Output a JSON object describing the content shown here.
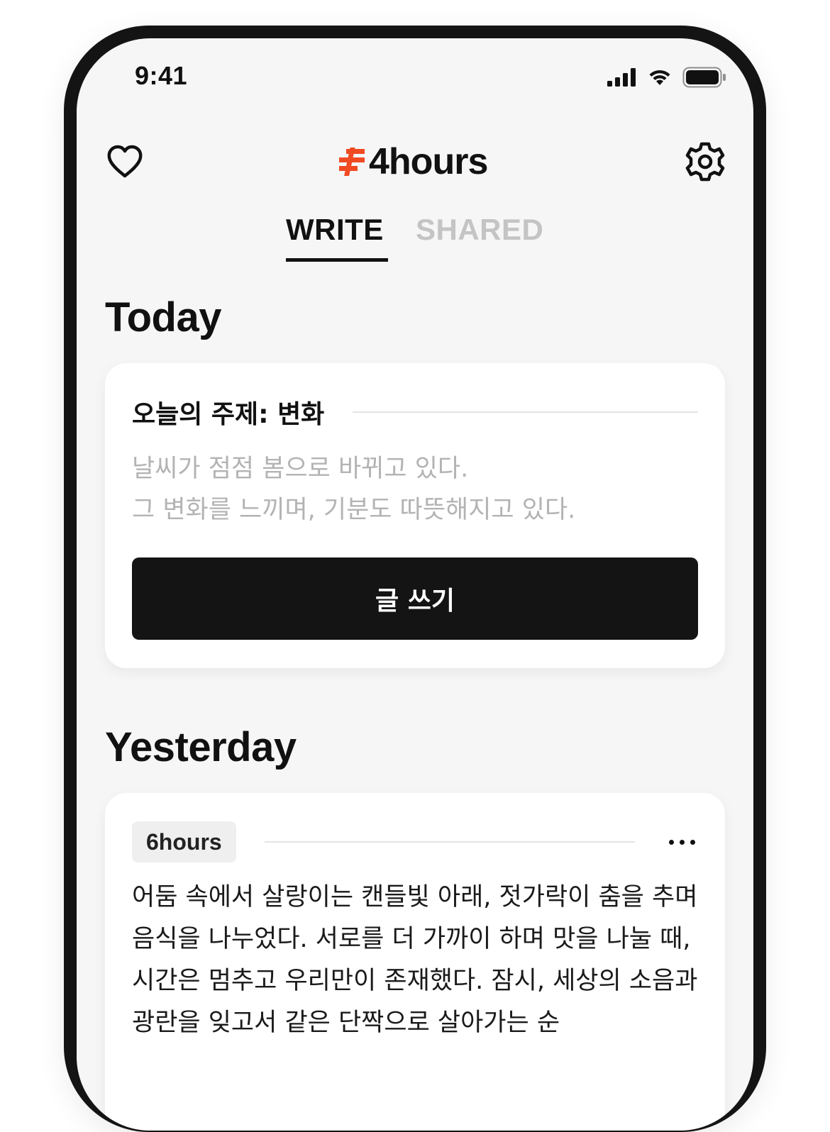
{
  "status_bar": {
    "time": "9:41",
    "icons": [
      "cellular-signal-icon",
      "wifi-icon",
      "battery-icon"
    ]
  },
  "header": {
    "logo_text": "4hours",
    "logo_mark_color": "#f04a23",
    "left_icon": "heart-icon",
    "right_icon": "gear-icon"
  },
  "tabs": [
    {
      "label": "WRITE",
      "active": true
    },
    {
      "label": "SHARED",
      "active": false
    }
  ],
  "today": {
    "title": "Today",
    "topic_label": "오늘의 주제: 변화",
    "topic_lines": [
      "날씨가 점점 봄으로 바뀌고 있다.",
      "그 변화를 느끼며, 기분도 따뜻해지고 있다."
    ],
    "write_button_label": "글 쓰기"
  },
  "yesterday": {
    "title": "Yesterday",
    "hours_badge": "6hours",
    "entry_text": "어둠 속에서 살랑이는 캔들빛 아래, 젓가락이 춤을 추며 음식을 나누었다. 서로를 더 가까이 하며 맛을 나눌 때, 시간은 멈추고 우리만이 존재했다. 잠시, 세상의 소음과 광란을 잊고서 같은 단짝으로 살아가는 순"
  },
  "colors": {
    "accent": "#f04a23",
    "dark": "#141414",
    "muted_text": "#b3b3b3",
    "inactive_tab": "#c4c4c4"
  }
}
